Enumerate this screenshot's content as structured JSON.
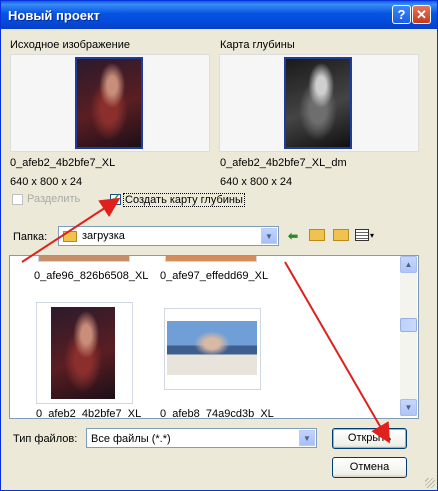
{
  "window": {
    "title": "Новый проект",
    "help_label": "?",
    "close_label": "✕"
  },
  "source": {
    "header": "Исходное изображение",
    "filename": "0_afeb2_4b2bfe7_XL",
    "dims": "640 x 800 x 24"
  },
  "depth": {
    "header": "Карта глубины",
    "filename": "0_afeb2_4b2bfe7_XL_dm",
    "dims": "640 x 800 x 24"
  },
  "options": {
    "split_label": "Разделить",
    "split_checked": false,
    "create_depth_label": "Создать карту глубины",
    "create_depth_checked": true
  },
  "folder": {
    "label": "Папка:",
    "value": "загрузка"
  },
  "files": [
    {
      "name": "0_afe96_826b6508_XL"
    },
    {
      "name": "0_afe97_effedd69_XL"
    },
    {
      "name": "0_afeb2_4b2bfe7_XL"
    },
    {
      "name": "0_afeb8_74a9cd3b_XL"
    }
  ],
  "filetype": {
    "label": "Тип файлов:",
    "value": "Все файлы (*.*)"
  },
  "buttons": {
    "open": "Открыть",
    "cancel": "Отмена"
  },
  "colors": {
    "titlebar": "#0054e3",
    "dialog_bg": "#ece9d8",
    "annotation_arrow": "#e0201c",
    "thumb_border": "#1d3c9c"
  }
}
